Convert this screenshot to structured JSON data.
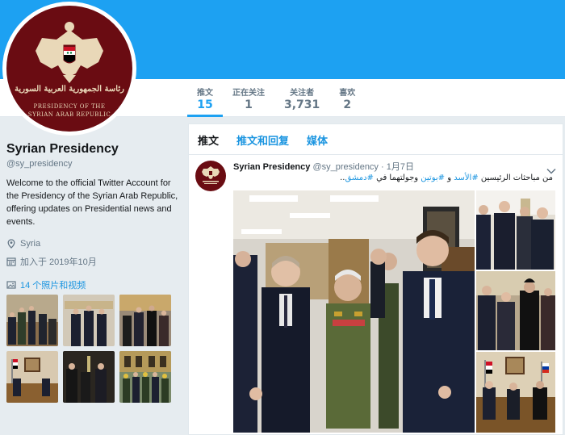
{
  "banner": {
    "color": "#1da1f2"
  },
  "avatar": {
    "seal_arabic": "رئاسة الجمهورية العربية السورية",
    "seal_line1": "PRESIDENCY OF THE",
    "seal_line2": "SYRIAN ARAB REPUBLIC",
    "bg_color": "#6a0c12"
  },
  "stats": [
    {
      "label": "推文",
      "value": "15",
      "active": true
    },
    {
      "label": "正在关注",
      "value": "1"
    },
    {
      "label": "关注者",
      "value": "3,731"
    },
    {
      "label": "喜欢",
      "value": "2"
    }
  ],
  "profile": {
    "name": "Syrian Presidency",
    "handle": "@sy_presidency",
    "bio": "Welcome to the official Twitter Account for the Presidency of the Syrian Arab Republic, offering updates on Presidential news and events.",
    "location": "Syria",
    "joined": "加入于 2019年10月",
    "photos_link": "14 个照片和视频",
    "icons": {
      "location": "location-pin-icon",
      "joined": "calendar-icon",
      "photos": "photo-icon"
    }
  },
  "tabs": [
    "推文",
    "推文和回复",
    "媒体"
  ],
  "tweet": {
    "name": "Syrian Presidency",
    "handle": "@sy_presidency",
    "separator": "·",
    "date": "1月7日",
    "text_part1": "من مباحثات الرئيسين ",
    "hashtag1": "#الأسد",
    "text_and": " و ",
    "hashtag2": "#بوتين",
    "text_part2": " وجولتهما في ",
    "hashtag3": "#دمشق",
    "text_end": ".."
  },
  "colors": {
    "link": "#1b95e0",
    "accent": "#1da1f2",
    "muted": "#657786",
    "maroon": "#6a0c12"
  }
}
